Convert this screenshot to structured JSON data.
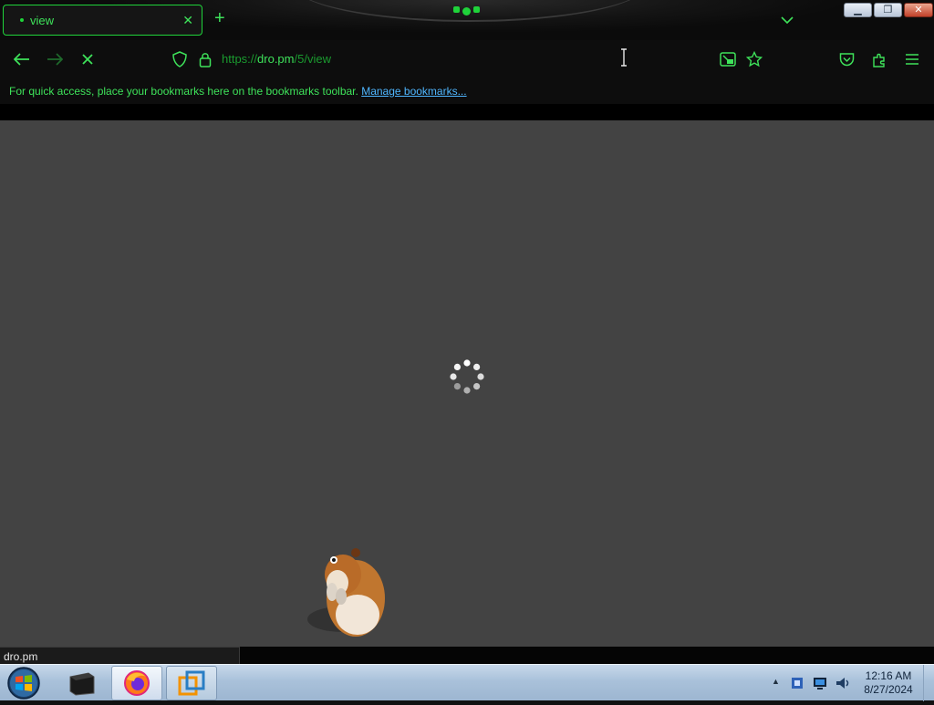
{
  "browser": {
    "tab": {
      "title": "view"
    },
    "url": {
      "scheme": "https://",
      "host": "dro.pm",
      "path": "/5/view"
    },
    "bookmarks_bar": {
      "message": "For quick access, place your bookmarks here on the bookmarks toolbar.",
      "link": "Manage bookmarks..."
    },
    "status_text": "dro.pm",
    "accent_color": "#3ee25a"
  },
  "page": {
    "background": "#434343",
    "state": "loading"
  },
  "taskbar": {
    "apps": [
      "terminal-icon",
      "firefox-icon",
      "vmware-icon"
    ],
    "clock": {
      "time": "12:16 AM",
      "date": "8/27/2024"
    }
  }
}
